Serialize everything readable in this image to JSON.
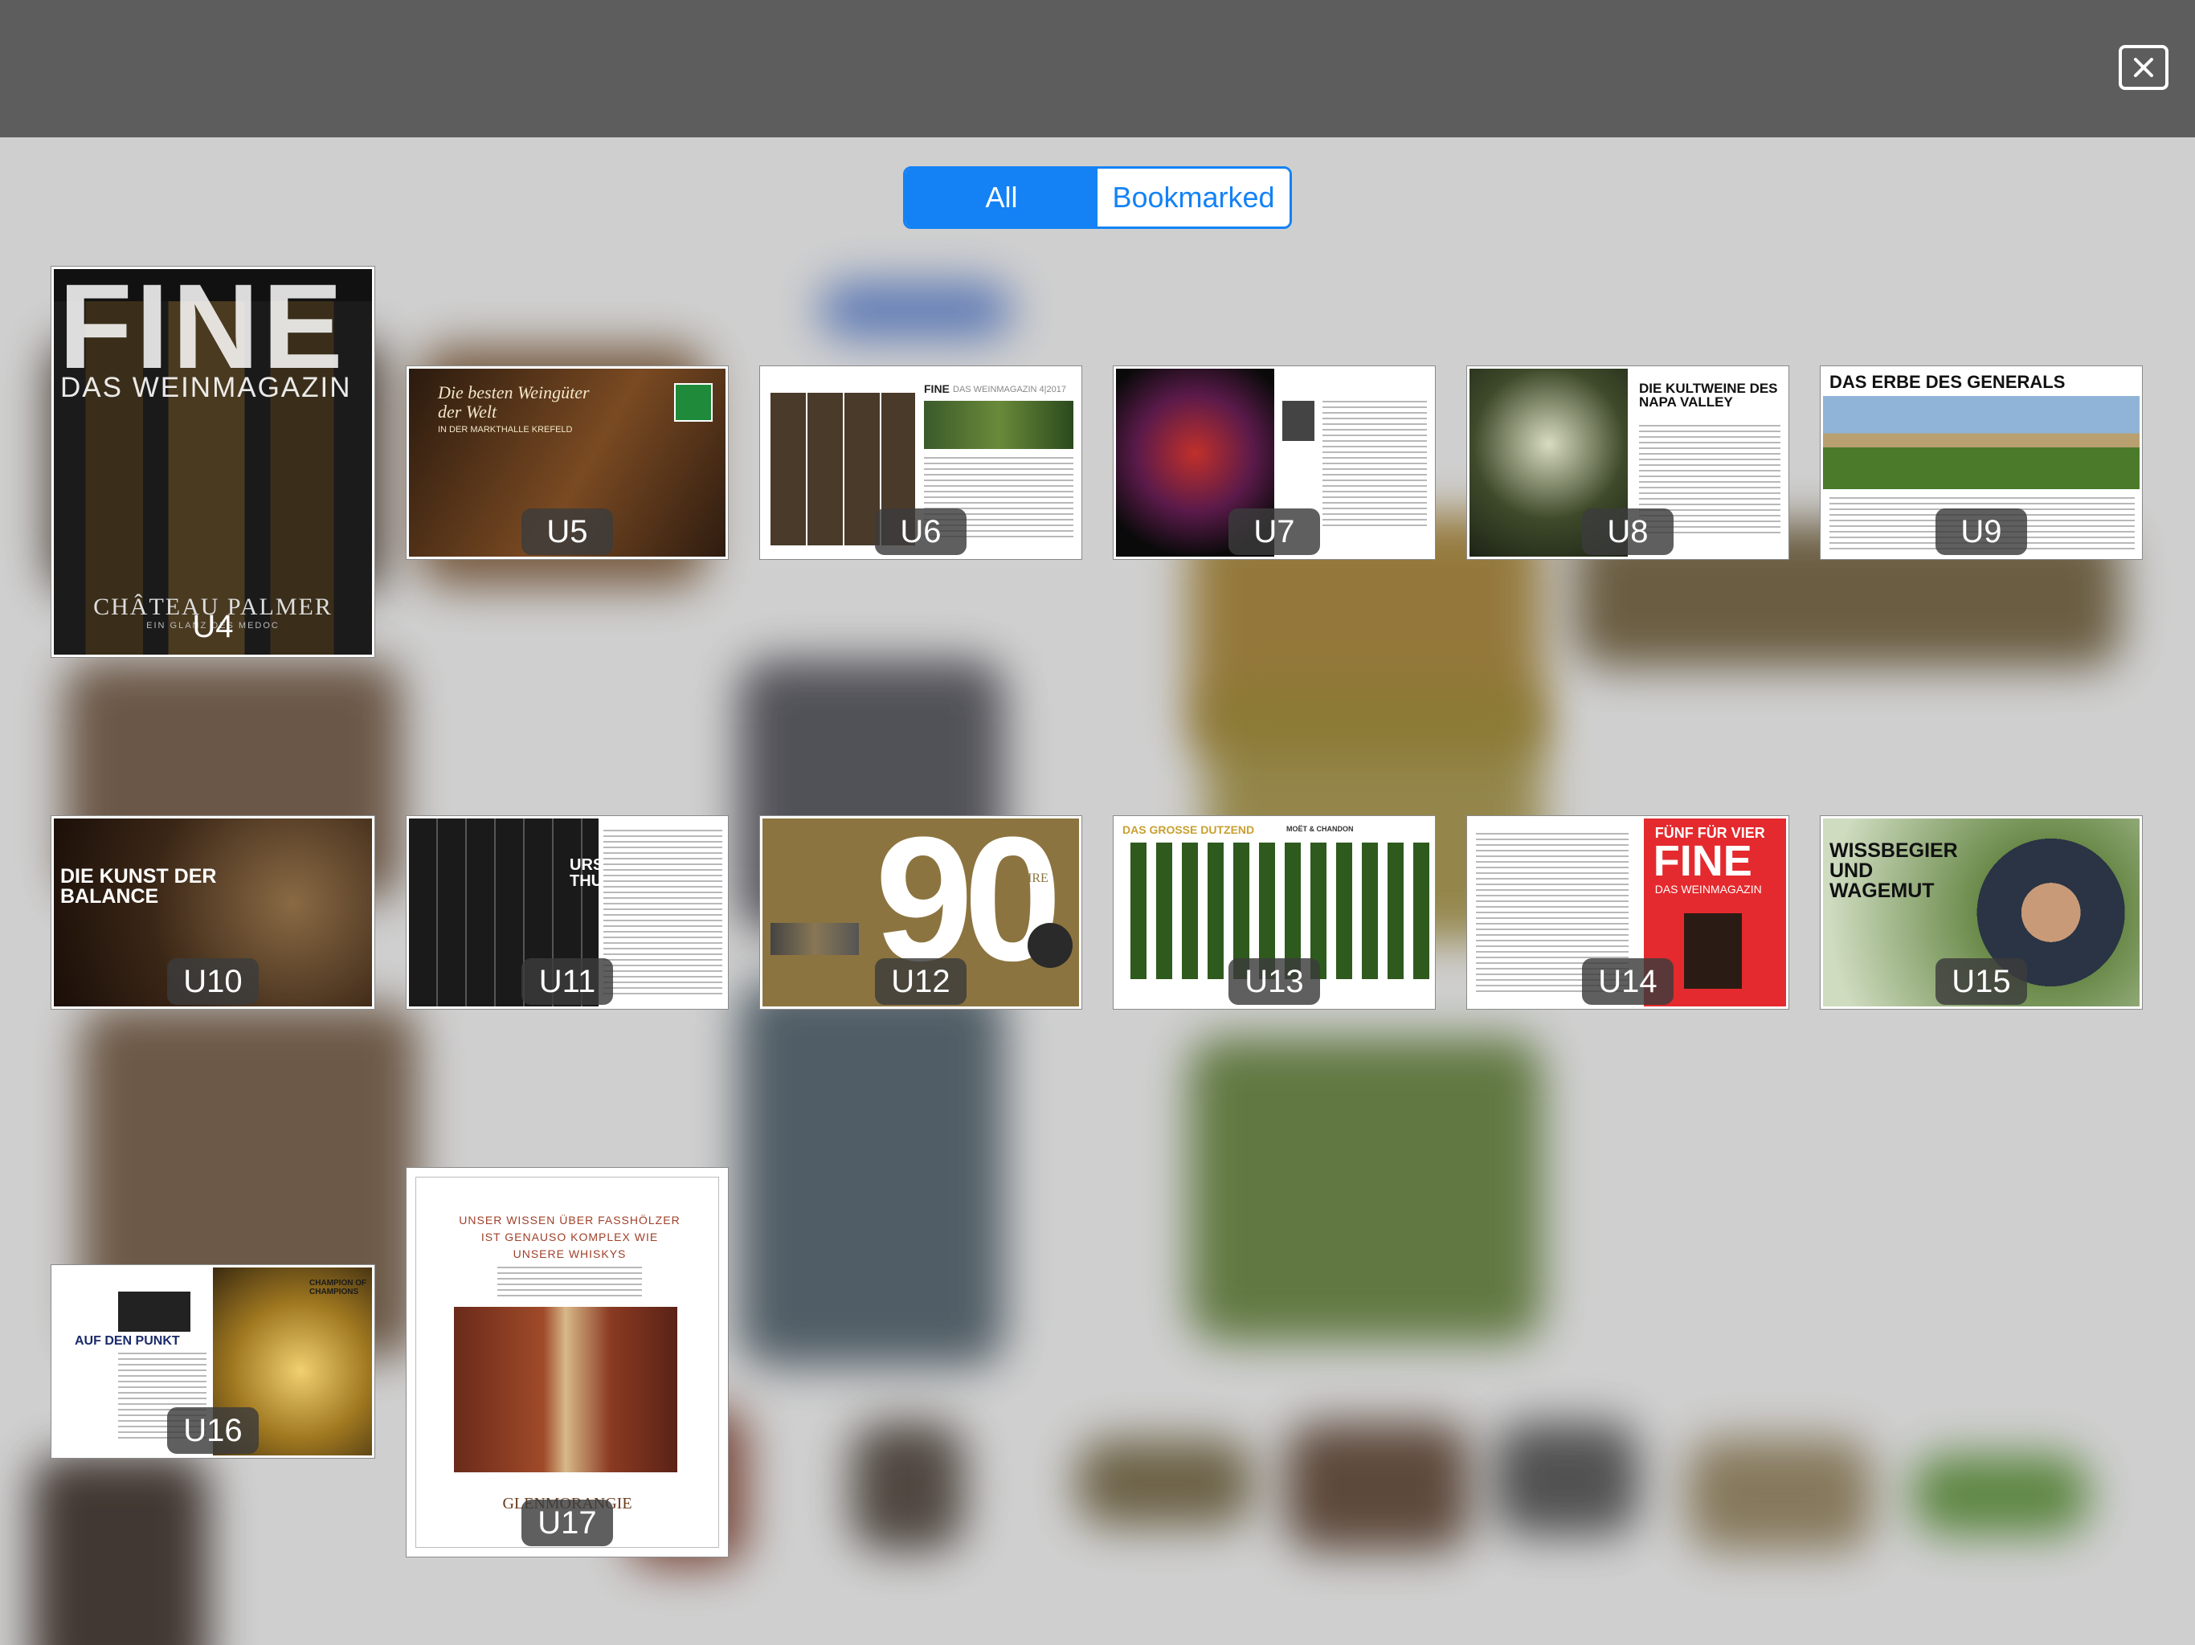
{
  "toolbar": {
    "close_icon": "close-icon"
  },
  "filter": {
    "options": [
      "All",
      "Bookmarked"
    ],
    "selected": "All",
    "accent_color": "#1482f5"
  },
  "cover": {
    "masthead": "FINE",
    "subtitle": "DAS WEINMAGAZIN",
    "headline": "CHÂTEAU PALMER",
    "tagline": "EIN GLANZ DES MEDOC"
  },
  "pages": [
    {
      "label": "U4"
    },
    {
      "label": "U5",
      "title": "Die besten Weingüter der Welt",
      "subtitle": "IN DER MARKTHALLE KREFELD"
    },
    {
      "label": "U6",
      "title": "FINE",
      "subtitle": "DAS WEINMAGAZIN 4|2017"
    },
    {
      "label": "U7"
    },
    {
      "label": "U8",
      "title": "DIE KULTWEINE DES NAPA VALLEY"
    },
    {
      "label": "U9",
      "title": "DAS ERBE DES GENERALS"
    },
    {
      "label": "U10",
      "title": "DIE KUNST DER BALANCE"
    },
    {
      "label": "U11",
      "title": "URSULA THURNER"
    },
    {
      "label": "U12",
      "title": "90",
      "subtitle": "JAHRE"
    },
    {
      "label": "U13",
      "title": "DAS GROSSE DUTZEND",
      "subtitle": "MOËT & CHANDON"
    },
    {
      "label": "U14",
      "title": "FÜNF FÜR VIER",
      "subtitle": "FINE",
      "tagline": "DAS WEINMAGAZIN"
    },
    {
      "label": "U15",
      "title": "WISSBEGIER UND WAGEMUT"
    },
    {
      "label": "U16",
      "title": "AUF DEN PUNKT",
      "subtitle": "CHAMPION OF CHAMPIONS"
    },
    {
      "label": "U17",
      "title": "UNSER WISSEN ÜBER FASSHÖLZER IST GENAUSO KOMPLEX WIE UNSERE WHISKYS",
      "subtitle": "GLENMORANGIE"
    }
  ]
}
